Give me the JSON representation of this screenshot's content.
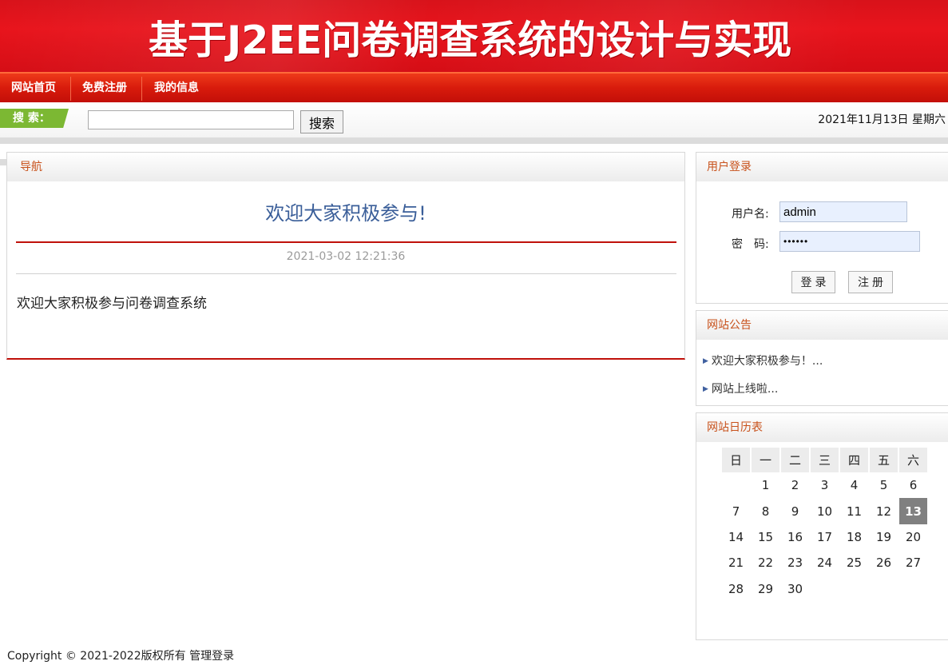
{
  "banner": {
    "title": "基于J2EE问卷调查系统的设计与实现"
  },
  "nav": {
    "items": [
      {
        "label": "网站首页"
      },
      {
        "label": "免费注册"
      },
      {
        "label": "我的信息"
      }
    ]
  },
  "search": {
    "tag_label": "搜 索：",
    "input_value": "",
    "button_label": "搜索",
    "date_text": "2021年11月13日 星期六"
  },
  "main": {
    "header": "导航",
    "article_title": "欢迎大家积极参与!",
    "article_time": "2021-03-02 12:21:36",
    "article_body": "欢迎大家积极参与问卷调查系统"
  },
  "login": {
    "header": "用户登录",
    "username_label": "用户名:",
    "username_value": "admin",
    "password_label": "密　码:",
    "password_value": "••••••",
    "login_button": "登录",
    "register_button": "注册"
  },
  "notice": {
    "header": "网站公告",
    "items": [
      {
        "label": "欢迎大家积极参与！..."
      },
      {
        "label": "网站上线啦..."
      }
    ]
  },
  "calendar": {
    "header": "网站日历表",
    "weekdays": [
      "日",
      "一",
      "二",
      "三",
      "四",
      "五",
      "六"
    ],
    "weeks": [
      [
        "",
        "1",
        "2",
        "3",
        "4",
        "5",
        "6"
      ],
      [
        "7",
        "8",
        "9",
        "10",
        "11",
        "12",
        "13"
      ],
      [
        "14",
        "15",
        "16",
        "17",
        "18",
        "19",
        "20"
      ],
      [
        "21",
        "22",
        "23",
        "24",
        "25",
        "26",
        "27"
      ],
      [
        "28",
        "29",
        "30",
        "",
        "",
        "",
        ""
      ]
    ],
    "today": "13"
  },
  "footer": {
    "copyright": "Copyright © 2021-2022版权所有",
    "admin_link": "管理登录"
  },
  "colors": {
    "banner_red": "#e8141c",
    "nav_red": "#d81b0c",
    "accent_orange": "#c8521c",
    "title_blue": "#3a5e99",
    "search_green": "#7cb833"
  }
}
